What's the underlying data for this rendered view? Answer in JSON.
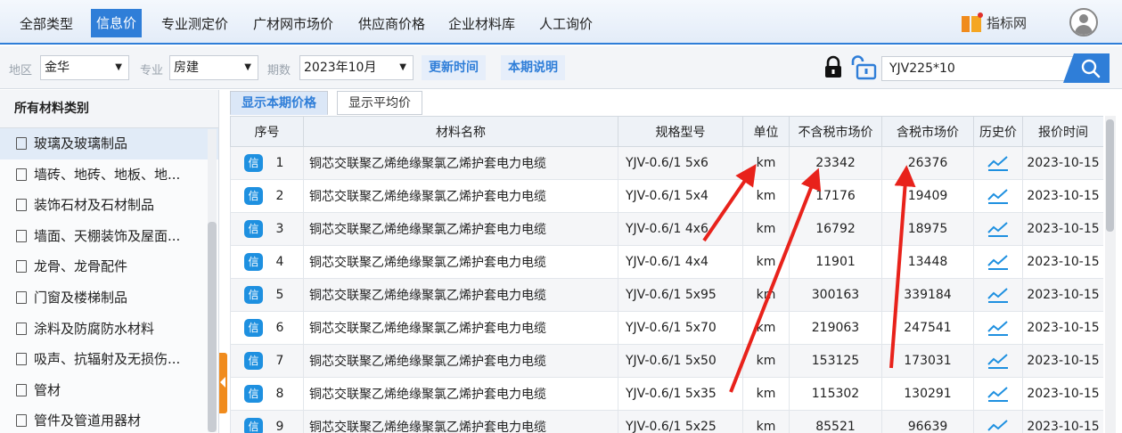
{
  "nav": {
    "tabs": [
      "全部类型",
      "信息价",
      "专业测定价",
      "广材网市场价",
      "供应商价格",
      "企业材料库",
      "人工询价"
    ],
    "active_index": 1,
    "brand": "指标网"
  },
  "filters": {
    "region_label": "地区",
    "region_value": "金华",
    "major_label": "专业",
    "major_value": "房建",
    "period_label": "期数",
    "period_value": "2023年10月",
    "update_time_btn": "更新时间",
    "period_note_btn": "本期说明",
    "search_value": "YJV225*10"
  },
  "sidebar": {
    "title": "所有材料类别",
    "items": [
      "玻璃及玻璃制品",
      "墙砖、地砖、地板、地...",
      "装饰石材及石材制品",
      "墙面、天棚装饰及屋面...",
      "龙骨、龙骨配件",
      "门窗及楼梯制品",
      "涂料及防腐防水材料",
      "吸声、抗辐射及无损伤...",
      "管材",
      "管件及管道用器材"
    ],
    "selected_index": 0
  },
  "subtabs": [
    "显示本期价格",
    "显示平均价"
  ],
  "table": {
    "headers": [
      "序号",
      "材料名称",
      "规格型号",
      "单位",
      "不含税市场价",
      "含税市场价",
      "历史价",
      "报价时间"
    ],
    "badge": "信",
    "rows": [
      {
        "no": "1",
        "name": "铜芯交联聚乙烯绝缘聚氯乙烯护套电力电缆",
        "spec": "YJV-0.6/1 5x6",
        "unit": "km",
        "price_ex": "23342",
        "price_in": "26376",
        "date": "2023-10-15"
      },
      {
        "no": "2",
        "name": "铜芯交联聚乙烯绝缘聚氯乙烯护套电力电缆",
        "spec": "YJV-0.6/1 5x4",
        "unit": "km",
        "price_ex": "17176",
        "price_in": "19409",
        "date": "2023-10-15"
      },
      {
        "no": "3",
        "name": "铜芯交联聚乙烯绝缘聚氯乙烯护套电力电缆",
        "spec": "YJV-0.6/1 4x6",
        "unit": "km",
        "price_ex": "16792",
        "price_in": "18975",
        "date": "2023-10-15"
      },
      {
        "no": "4",
        "name": "铜芯交联聚乙烯绝缘聚氯乙烯护套电力电缆",
        "spec": "YJV-0.6/1 4x4",
        "unit": "km",
        "price_ex": "11901",
        "price_in": "13448",
        "date": "2023-10-15"
      },
      {
        "no": "5",
        "name": "铜芯交联聚乙烯绝缘聚氯乙烯护套电力电缆",
        "spec": "YJV-0.6/1 5x95",
        "unit": "km",
        "price_ex": "300163",
        "price_in": "339184",
        "date": "2023-10-15"
      },
      {
        "no": "6",
        "name": "铜芯交联聚乙烯绝缘聚氯乙烯护套电力电缆",
        "spec": "YJV-0.6/1 5x70",
        "unit": "km",
        "price_ex": "219063",
        "price_in": "247541",
        "date": "2023-10-15"
      },
      {
        "no": "7",
        "name": "铜芯交联聚乙烯绝缘聚氯乙烯护套电力电缆",
        "spec": "YJV-0.6/1 5x50",
        "unit": "km",
        "price_ex": "153125",
        "price_in": "173031",
        "date": "2023-10-15"
      },
      {
        "no": "8",
        "name": "铜芯交联聚乙烯绝缘聚氯乙烯护套电力电缆",
        "spec": "YJV-0.6/1 5x35",
        "unit": "km",
        "price_ex": "115302",
        "price_in": "130291",
        "date": "2023-10-15"
      },
      {
        "no": "9",
        "name": "铜芯交联聚乙烯绝缘聚氯乙烯护套电力电缆",
        "spec": "YJV-0.6/1 5x25",
        "unit": "km",
        "price_ex": "85521",
        "price_in": "96639",
        "date": "2023-10-15"
      }
    ]
  },
  "colors": {
    "accent": "#2f7ed8",
    "badge": "#1e90e0",
    "brand_orange": "#f08b1d",
    "annotation_arrow": "#e8221b"
  }
}
